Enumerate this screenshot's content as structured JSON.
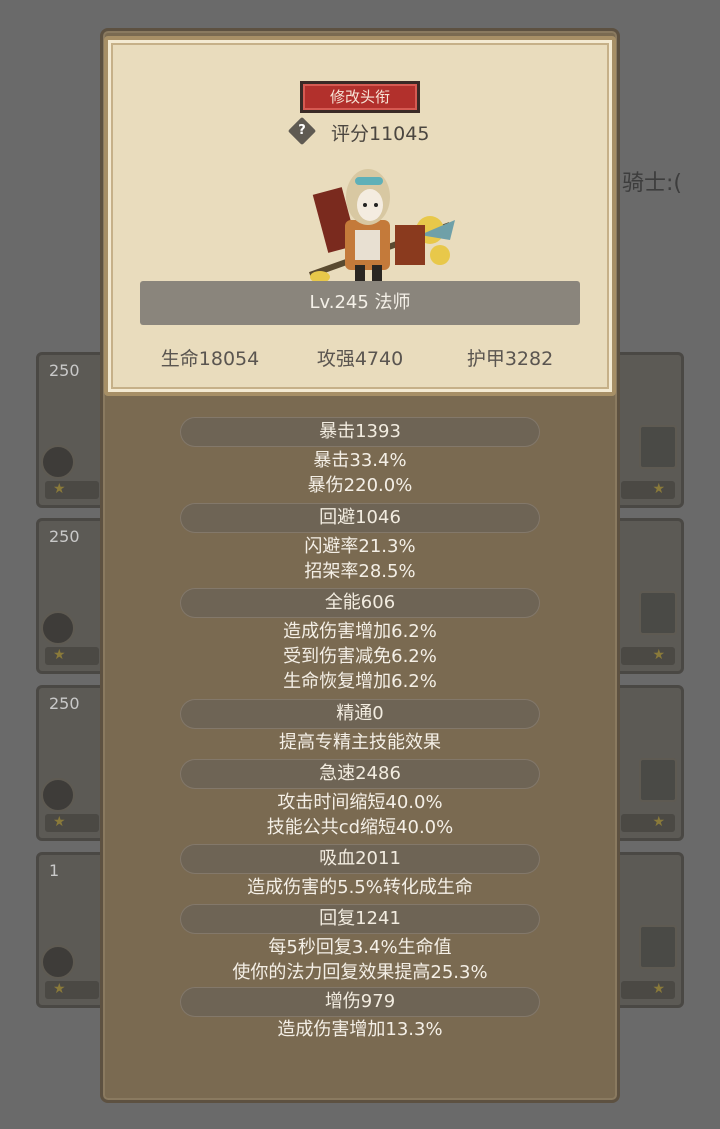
{
  "background": {
    "left_cards": [
      {
        "level": "250"
      },
      {
        "level": "250"
      },
      {
        "level": "250"
      },
      {
        "level": "1"
      }
    ],
    "partial_text": "骑士:("
  },
  "panel": {
    "rename_button": "修改头衔",
    "score_icon": "question-mark-icon",
    "score_text": "评分11045",
    "hero_name": "Lv.245 法师",
    "main_stats": {
      "hp": "生命18054",
      "attack": "攻强4740",
      "armor": "护甲3282"
    }
  },
  "stats": {
    "crit": {
      "header": "暴击1393",
      "lines": [
        "暴击33.4%",
        "暴伤220.0%"
      ]
    },
    "dodge": {
      "header": "回避1046",
      "lines": [
        "闪避率21.3%",
        "招架率28.5%"
      ]
    },
    "versatility": {
      "header": "全能606",
      "lines": [
        "造成伤害增加6.2%",
        "受到伤害减免6.2%",
        "生命恢复增加6.2%"
      ]
    },
    "mastery": {
      "header": "精通0",
      "lines": [
        "提高专精主技能效果"
      ]
    },
    "haste": {
      "header": "急速2486",
      "lines": [
        "攻击时间缩短40.0%",
        "技能公共cd缩短40.0%"
      ]
    },
    "lifesteal": {
      "header": "吸血2011",
      "lines": [
        "造成伤害的5.5%转化成生命"
      ]
    },
    "regen": {
      "header": "回复1241",
      "lines": [
        "每5秒回复3.4%生命值",
        "使你的法力回复效果提高25.3%"
      ]
    },
    "dmg_boost": {
      "header": "增伤979",
      "lines": [
        "造成伤害增加13.3%"
      ]
    }
  }
}
